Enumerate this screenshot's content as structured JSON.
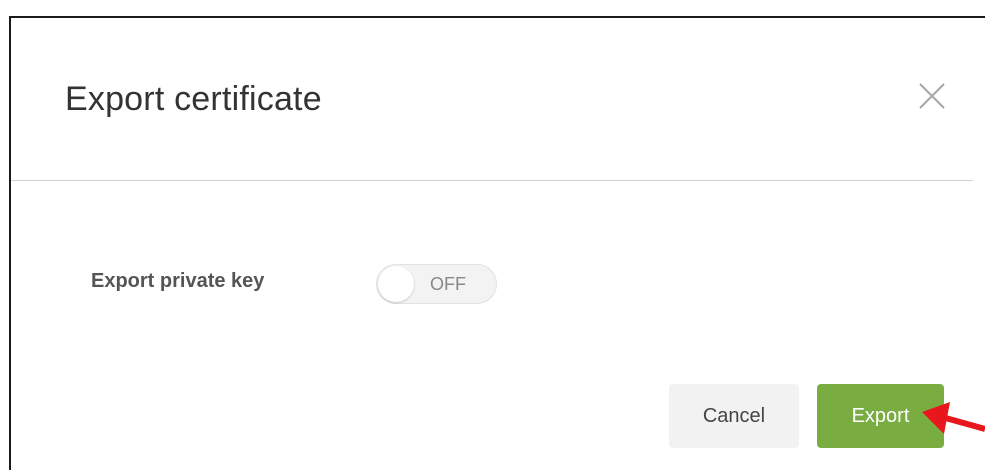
{
  "dialog": {
    "title": "Export certificate",
    "close_icon": "close-icon",
    "fields": {
      "export_private_key": {
        "label": "Export private key",
        "toggle_state": "OFF"
      }
    },
    "buttons": {
      "cancel_label": "Cancel",
      "export_label": "Export"
    }
  },
  "colors": {
    "export_button": "#79ad42",
    "annotation_arrow": "#e8171d"
  },
  "icons": [
    "close-icon",
    "red-arrow-pointer-icon"
  ]
}
